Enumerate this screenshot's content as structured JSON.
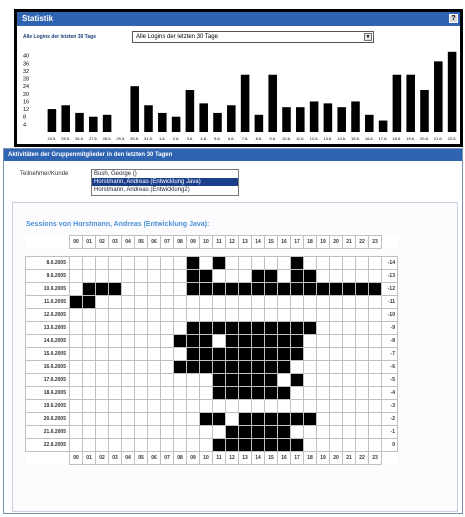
{
  "panel": {
    "title": "Statistik",
    "help_label": "?",
    "filter_label": "Alle Logins der letzten 30 Tage",
    "filter_value": "Alle Logins der letzten 30 Tage"
  },
  "chart_data": {
    "type": "bar",
    "categories": [
      "24.5.",
      "25.5.",
      "26.5.",
      "27.5.",
      "28.5.",
      "29.5.",
      "30.5.",
      "31.5.",
      "1.6.",
      "2.6.",
      "3.6.",
      "4.6.",
      "5.6.",
      "6.6.",
      "7.6.",
      "8.6.",
      "9.6.",
      "10.6.",
      "11.6.",
      "12.6.",
      "13.6.",
      "14.6.",
      "15.6.",
      "16.6.",
      "17.6.",
      "18.6.",
      "19.6.",
      "20.6.",
      "21.6.",
      "22.6."
    ],
    "values": [
      12,
      14,
      10,
      8,
      9,
      0,
      24,
      14,
      10,
      8,
      22,
      15,
      10,
      14,
      30,
      9,
      30,
      13,
      13,
      16,
      15,
      13,
      16,
      9,
      6,
      30,
      30,
      22,
      37,
      42
    ],
    "yticks": [
      4,
      8,
      12,
      16,
      20,
      24,
      28,
      32,
      36,
      40
    ],
    "ylim": [
      0,
      44
    ]
  },
  "sessions": {
    "header": "Aktivitäten der Gruppenmitglieder in den letzten 30 Tagen",
    "participant_label": "Teilnehmer/Kunde",
    "participants": [
      {
        "name": "Bush, George ()",
        "selected": false
      },
      {
        "name": "Horstmann, Andreas (Entwicklung Java)",
        "selected": true
      },
      {
        "name": "Horstmann, Andreas (Entwicklung2)",
        "selected": false
      }
    ],
    "title": "Sessions von Horstmann, Andreas (Entwicklung Java):",
    "hours": [
      "00",
      "01",
      "02",
      "03",
      "04",
      "05",
      "06",
      "07",
      "08",
      "09",
      "10",
      "11",
      "12",
      "13",
      "14",
      "15",
      "16",
      "17",
      "18",
      "19",
      "20",
      "21",
      "22",
      "23"
    ],
    "rows": [
      {
        "date": "8.6.2005",
        "rel": "-14",
        "active": [
          9,
          11,
          17
        ]
      },
      {
        "date": "9.6.2005",
        "rel": "-13",
        "active": [
          9,
          10,
          14,
          15,
          17,
          18
        ]
      },
      {
        "date": "10.6.2005",
        "rel": "-12",
        "active": [
          1,
          2,
          3,
          9,
          10,
          11,
          12,
          13,
          14,
          15,
          16,
          17,
          18,
          19,
          20,
          21,
          22,
          23
        ]
      },
      {
        "date": "11.6.2005",
        "rel": "-11",
        "active": [
          0,
          1
        ]
      },
      {
        "date": "12.6.2005",
        "rel": "-10",
        "active": []
      },
      {
        "date": "13.6.2005",
        "rel": "-9",
        "active": [
          9,
          10,
          11,
          12,
          13,
          14,
          15,
          16,
          17,
          18
        ]
      },
      {
        "date": "14.6.2005",
        "rel": "-8",
        "active": [
          8,
          9,
          10,
          12,
          13,
          14,
          15,
          16,
          17
        ]
      },
      {
        "date": "15.6.2005",
        "rel": "-7",
        "active": [
          9,
          10,
          11,
          12,
          13,
          14,
          15,
          16,
          17
        ]
      },
      {
        "date": "16.6.2005",
        "rel": "-6",
        "active": [
          8,
          9,
          10,
          11,
          12,
          13,
          14,
          15,
          16
        ]
      },
      {
        "date": "17.6.2005",
        "rel": "-5",
        "active": [
          11,
          12,
          13,
          14,
          15,
          17
        ]
      },
      {
        "date": "18.6.2005",
        "rel": "-4",
        "active": [
          11,
          12,
          13,
          14,
          15,
          16
        ]
      },
      {
        "date": "19.6.2005",
        "rel": "-3",
        "active": []
      },
      {
        "date": "20.6.2005",
        "rel": "-2",
        "active": [
          10,
          11,
          13,
          14,
          15,
          16,
          17,
          18
        ]
      },
      {
        "date": "21.6.2005",
        "rel": "-1",
        "active": [
          12,
          13,
          14,
          15,
          16
        ]
      },
      {
        "date": "22.6.2005",
        "rel": "0",
        "active": [
          11,
          12,
          13,
          14,
          15,
          16,
          17
        ]
      }
    ]
  }
}
